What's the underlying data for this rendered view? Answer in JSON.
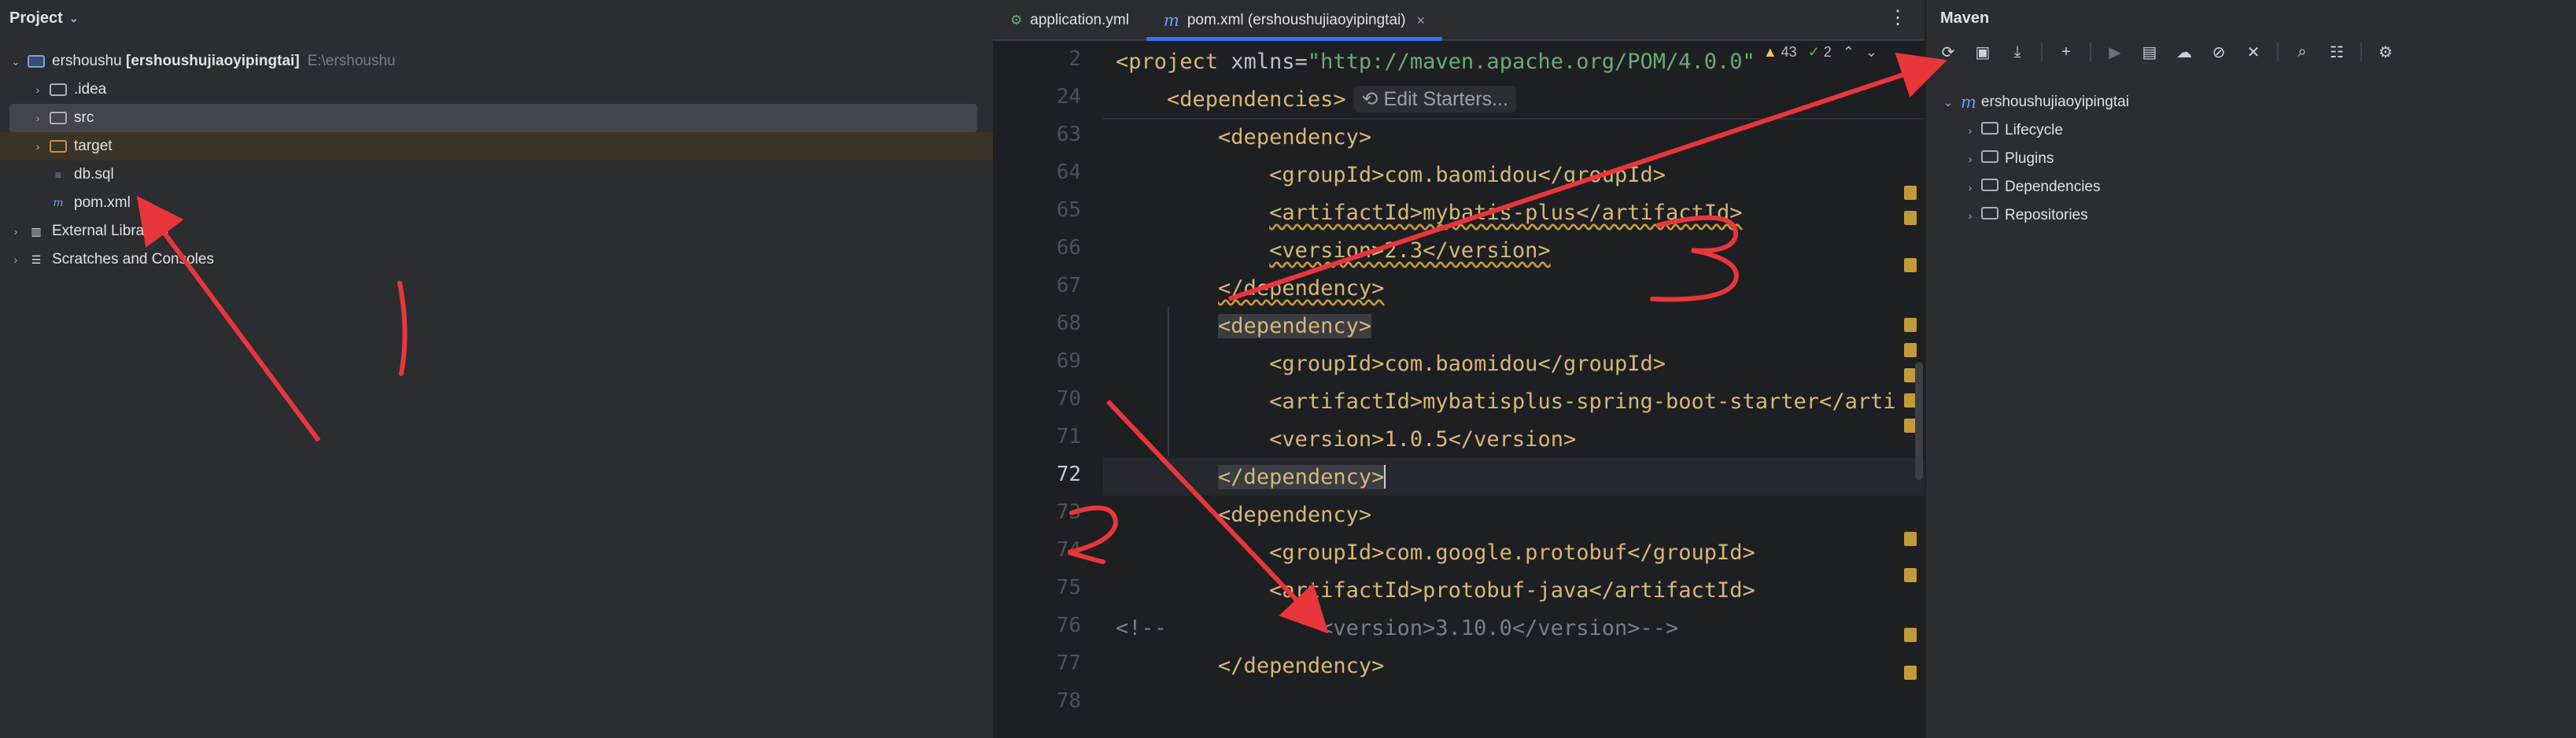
{
  "project": {
    "title": "Project",
    "root_name": "ershoushu",
    "root_module": "[ershoushujiaoyipingtai]",
    "root_path": "E:\\ershoushu",
    "items": [
      {
        "label": ".idea"
      },
      {
        "label": "src"
      },
      {
        "label": "target"
      },
      {
        "label": "db.sql"
      },
      {
        "label": "pom.xml"
      },
      {
        "label": "External Libraries"
      },
      {
        "label": "Scratches and Consoles"
      }
    ]
  },
  "editor": {
    "tabs": [
      {
        "label": "application.yml",
        "active": false
      },
      {
        "label": "pom.xml (ershoushujiaoyipingtai)",
        "active": true
      }
    ],
    "inspections": {
      "warnings": "43",
      "ok": "2"
    },
    "edit_starters": "Edit Starters...",
    "lines": [
      {
        "n": "2",
        "indent": "",
        "text": ""
      },
      {
        "n": "24",
        "indent": "    ",
        "text": ""
      },
      {
        "n": "63",
        "indent": "        ",
        "text": "<dependency>"
      },
      {
        "n": "64",
        "indent": "            ",
        "text": "<groupId>com.baomidou</groupId>"
      },
      {
        "n": "65",
        "indent": "            ",
        "text": "<artifactId>mybatis-plus</artifactId>"
      },
      {
        "n": "66",
        "indent": "            ",
        "text": "<version>2.3</version>"
      },
      {
        "n": "67",
        "indent": "        ",
        "text": "</dependency>"
      },
      {
        "n": "68",
        "indent": "        ",
        "text": "<dependency>"
      },
      {
        "n": "69",
        "indent": "            ",
        "text": "<groupId>com.baomidou</groupId>"
      },
      {
        "n": "70",
        "indent": "            ",
        "text": "<artifactId>mybatisplus-spring-boot-starter</arti"
      },
      {
        "n": "71",
        "indent": "            ",
        "text": "<version>1.0.5</version>"
      },
      {
        "n": "72",
        "indent": "        ",
        "text": "</dependency>"
      },
      {
        "n": "73",
        "indent": "        ",
        "text": "<dependency>"
      },
      {
        "n": "74",
        "indent": "            ",
        "text": "<groupId>com.google.protobuf</groupId>"
      },
      {
        "n": "75",
        "indent": "            ",
        "text": "<artifactId>protobuf-java</artifactId>"
      },
      {
        "n": "76",
        "indent": "",
        "text": "<!--            <version>3.10.0</version>-->"
      },
      {
        "n": "77",
        "indent": "        ",
        "text": "</dependency>"
      },
      {
        "n": "78",
        "indent": "",
        "text": ""
      }
    ],
    "line2_tag_open": "<project ",
    "line2_attr": "xmlns=",
    "line2_value": "\"http://maven.apache.org/POM/4.0.0\"",
    "line24_text": "<dependencies>"
  },
  "maven": {
    "title": "Maven",
    "root": "ershoushujiaoyipingtai",
    "children": [
      {
        "label": "Lifecycle"
      },
      {
        "label": "Plugins"
      },
      {
        "label": "Dependencies"
      },
      {
        "label": "Repositories"
      }
    ]
  },
  "annotations": {
    "mark1": "1",
    "mark2": "2",
    "mark3": "3"
  }
}
